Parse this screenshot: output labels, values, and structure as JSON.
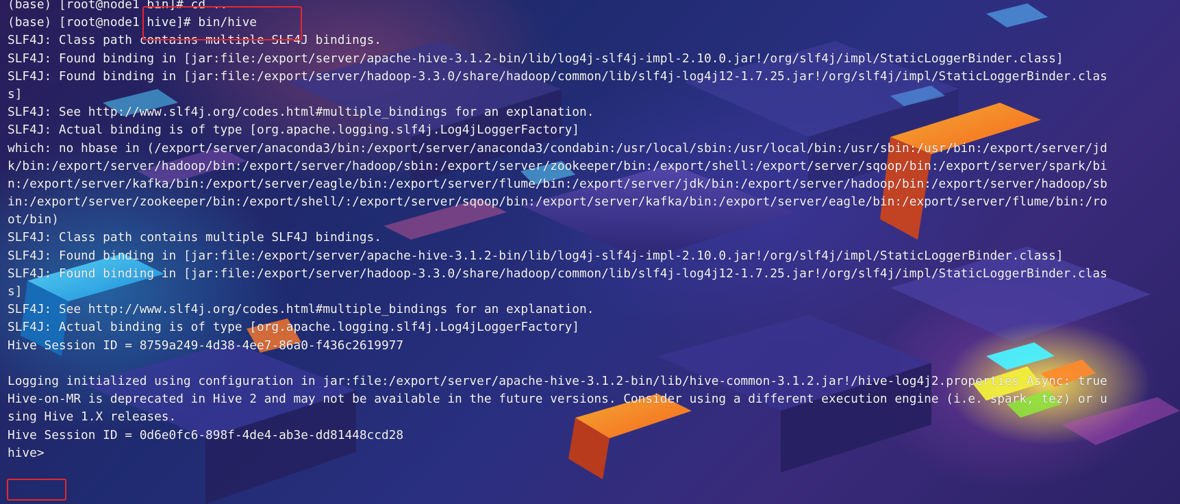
{
  "terminal": {
    "lines": [
      "(base) [root@node1 bin]# cd ..",
      "(base) [root@node1 hive]# bin/hive",
      "SLF4J: Class path contains multiple SLF4J bindings.",
      "SLF4J: Found binding in [jar:file:/export/server/apache-hive-3.1.2-bin/lib/log4j-slf4j-impl-2.10.0.jar!/org/slf4j/impl/StaticLoggerBinder.class]",
      "SLF4J: Found binding in [jar:file:/export/server/hadoop-3.3.0/share/hadoop/common/lib/slf4j-log4j12-1.7.25.jar!/org/slf4j/impl/StaticLoggerBinder.clas",
      "s]",
      "SLF4J: See http://www.slf4j.org/codes.html#multiple_bindings for an explanation.",
      "SLF4J: Actual binding is of type [org.apache.logging.slf4j.Log4jLoggerFactory]",
      "which: no hbase in (/export/server/anaconda3/bin:/export/server/anaconda3/condabin:/usr/local/sbin:/usr/local/bin:/usr/sbin:/usr/bin:/export/server/jd",
      "k/bin:/export/server/hadoop/bin:/export/server/hadoop/sbin:/export/server/zookeeper/bin:/export/shell:/export/server/sqoop/bin:/export/server/spark/bi",
      "n:/export/server/kafka/bin:/export/server/eagle/bin:/export/server/flume/bin:/export/server/jdk/bin:/export/server/hadoop/bin:/export/server/hadoop/sb",
      "in:/export/server/zookeeper/bin:/export/shell/:/export/server/sqoop/bin:/export/server/kafka/bin:/export/server/eagle/bin:/export/server/flume/bin:/ro",
      "ot/bin)",
      "SLF4J: Class path contains multiple SLF4J bindings.",
      "SLF4J: Found binding in [jar:file:/export/server/apache-hive-3.1.2-bin/lib/log4j-slf4j-impl-2.10.0.jar!/org/slf4j/impl/StaticLoggerBinder.class]",
      "SLF4J: Found binding in [jar:file:/export/server/hadoop-3.3.0/share/hadoop/common/lib/slf4j-log4j12-1.7.25.jar!/org/slf4j/impl/StaticLoggerBinder.clas",
      "s]",
      "SLF4J: See http://www.slf4j.org/codes.html#multiple_bindings for an explanation.",
      "SLF4J: Actual binding is of type [org.apache.logging.slf4j.Log4jLoggerFactory]",
      "Hive Session ID = 8759a249-4d38-4ee7-86a0-f436c2619977",
      "",
      "Logging initialized using configuration in jar:file:/export/server/apache-hive-3.1.2-bin/lib/hive-common-3.1.2.jar!/hive-log4j2.properties Async: true",
      "Hive-on-MR is deprecated in Hive 2 and may not be available in the future versions. Consider using a different execution engine (i.e. spark, tez) or u",
      "sing Hive 1.X releases.",
      "Hive Session ID = 0d6e0fc6-898f-4de4-ab3e-dd81448ccd28",
      "hive> "
    ]
  },
  "colors": {
    "text": "#f4f4f4",
    "highlight": "#e8262c"
  }
}
